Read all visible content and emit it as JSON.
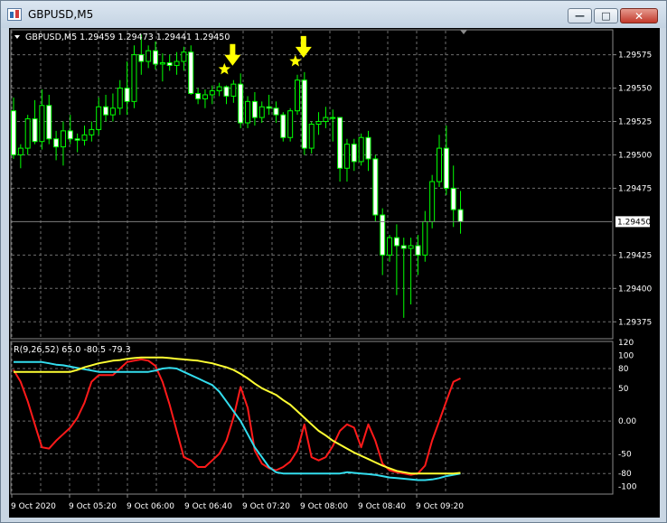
{
  "window": {
    "title": "GBPUSD,M5",
    "buttons": {
      "minimize_icon": "minimize-icon",
      "maximize_icon": "maximize-icon",
      "close_icon": "close-icon"
    }
  },
  "chart_data": [
    {
      "type": "candlestick",
      "header": "GBPUSD,M5  1.29459 1.29473 1.29441 1.29450",
      "symbol": "GBPUSD",
      "timeframe": "M5",
      "ohlc_text": "1.29459 1.29473 1.29441 1.29450",
      "ylim": [
        1.29363,
        1.29593
      ],
      "price_ticks": [
        "1.29575",
        "1.29550",
        "1.29525",
        "1.29500",
        "1.29475",
        "1.29425",
        "1.29400",
        "1.29375"
      ],
      "current_price": "1.29450",
      "current_price_value": 1.2945,
      "grid": true,
      "colors": {
        "background": "#000000",
        "candle": "#00ff00",
        "grid": "#6e6e6e",
        "signal": "#ffff00",
        "price_line": "#7f7f7f"
      },
      "signal_candles": [
        31,
        41
      ],
      "candles": [
        [
          1.29533,
          1.29543,
          1.29497,
          1.295
        ],
        [
          1.295,
          1.29508,
          1.2949,
          1.29505
        ],
        [
          1.29505,
          1.2953,
          1.295,
          1.29527
        ],
        [
          1.29527,
          1.29541,
          1.29508,
          1.2951
        ],
        [
          1.2951,
          1.29549,
          1.29504,
          1.29537
        ],
        [
          1.29537,
          1.29545,
          1.29508,
          1.29512
        ],
        [
          1.29512,
          1.29518,
          1.29496,
          1.29506
        ],
        [
          1.29506,
          1.29525,
          1.29492,
          1.29518
        ],
        [
          1.29518,
          1.2953,
          1.29508,
          1.29512
        ],
        [
          1.29512,
          1.29516,
          1.29502,
          1.29511
        ],
        [
          1.29511,
          1.29522,
          1.29507,
          1.29515
        ],
        [
          1.29515,
          1.29525,
          1.2951,
          1.29519
        ],
        [
          1.29519,
          1.29543,
          1.29515,
          1.29536
        ],
        [
          1.29536,
          1.29545,
          1.29525,
          1.2953
        ],
        [
          1.2953,
          1.29546,
          1.29525,
          1.29535
        ],
        [
          1.29535,
          1.29556,
          1.2953,
          1.2955
        ],
        [
          1.2955,
          1.2957,
          1.2953,
          1.2954
        ],
        [
          1.2954,
          1.29582,
          1.29535,
          1.29575
        ],
        [
          1.29575,
          1.2959,
          1.2956,
          1.2957
        ],
        [
          1.2957,
          1.29582,
          1.29565,
          1.29578
        ],
        [
          1.29578,
          1.29585,
          1.29564,
          1.29568
        ],
        [
          1.29568,
          1.29576,
          1.29555,
          1.29569
        ],
        [
          1.29569,
          1.29575,
          1.29563,
          1.29567
        ],
        [
          1.29567,
          1.29577,
          1.2956,
          1.2957
        ],
        [
          1.2957,
          1.29581,
          1.29563,
          1.29577
        ],
        [
          1.29577,
          1.29582,
          1.29545,
          1.29546
        ],
        [
          1.29546,
          1.2955,
          1.29538,
          1.29542
        ],
        [
          1.29542,
          1.29549,
          1.29535,
          1.29545
        ],
        [
          1.29545,
          1.29552,
          1.29538,
          1.29548
        ],
        [
          1.29548,
          1.29554,
          1.29544,
          1.29551
        ],
        [
          1.29551,
          1.29552,
          1.29538,
          1.29544
        ],
        [
          1.29544,
          1.29556,
          1.29539,
          1.29553
        ],
        [
          1.29553,
          1.29561,
          1.2952,
          1.29524
        ],
        [
          1.29524,
          1.29544,
          1.2952,
          1.2954
        ],
        [
          1.2954,
          1.29547,
          1.29522,
          1.29528
        ],
        [
          1.29528,
          1.2954,
          1.29524,
          1.29536
        ],
        [
          1.29536,
          1.29545,
          1.2953,
          1.29535
        ],
        [
          1.29535,
          1.2954,
          1.29524,
          1.2953
        ],
        [
          1.2953,
          1.29532,
          1.2951,
          1.29513
        ],
        [
          1.29513,
          1.29535,
          1.2951,
          1.29533
        ],
        [
          1.29533,
          1.2956,
          1.2953,
          1.29556
        ],
        [
          1.29556,
          1.29562,
          1.295,
          1.29505
        ],
        [
          1.29505,
          1.29525,
          1.29501,
          1.29523
        ],
        [
          1.29523,
          1.29532,
          1.29515,
          1.29525
        ],
        [
          1.29525,
          1.29536,
          1.2952,
          1.29528
        ],
        [
          1.29528,
          1.29534,
          1.2951,
          1.29528
        ],
        [
          1.29528,
          1.29526,
          1.2948,
          1.2949
        ],
        [
          1.2949,
          1.29512,
          1.2948,
          1.29508
        ],
        [
          1.29508,
          1.29512,
          1.29488,
          1.29495
        ],
        [
          1.29495,
          1.29516,
          1.29492,
          1.29513
        ],
        [
          1.29513,
          1.29518,
          1.29488,
          1.29497
        ],
        [
          1.29497,
          1.295,
          1.2945,
          1.29455
        ],
        [
          1.29455,
          1.2946,
          1.2941,
          1.29425
        ],
        [
          1.29425,
          1.2944,
          1.2942,
          1.29438
        ],
        [
          1.29438,
          1.29448,
          1.29395,
          1.29432
        ],
        [
          1.29432,
          1.29438,
          1.29378,
          1.2943
        ],
        [
          1.2943,
          1.29438,
          1.29388,
          1.29432
        ],
        [
          1.29432,
          1.2944,
          1.2941,
          1.29425
        ],
        [
          1.29425,
          1.29458,
          1.2942,
          1.2945
        ],
        [
          1.2945,
          1.29485,
          1.29445,
          1.2948
        ],
        [
          1.2948,
          1.29515,
          1.29476,
          1.29505
        ],
        [
          1.29505,
          1.29522,
          1.2947,
          1.29475
        ],
        [
          1.29475,
          1.29492,
          1.29446,
          1.29459
        ],
        [
          1.29459,
          1.29473,
          1.29441,
          1.2945
        ]
      ],
      "time_labels": [
        "9 Oct 2020",
        "9 Oct 05:20",
        "9 Oct 06:00",
        "9 Oct 06:40",
        "9 Oct 07:20",
        "9 Oct 08:00",
        "9 Oct 08:40",
        "9 Oct 09:20"
      ]
    },
    {
      "type": "line",
      "header": "R(9,26,52) 65.0 -80.5 -79.3",
      "ylim": [
        -110,
        120
      ],
      "y_ticks": [
        "120",
        "100",
        "80",
        "50",
        "0.00",
        "-50",
        "-80",
        "-100"
      ],
      "y_tick_values": [
        120,
        100,
        80,
        50,
        0,
        -50,
        -80,
        -100
      ],
      "grid": true,
      "series": [
        {
          "color": "#ff1a1a",
          "values": [
            78,
            60,
            30,
            -5,
            -40,
            -42,
            -30,
            -20,
            -10,
            5,
            28,
            60,
            70,
            70,
            70,
            80,
            90,
            92,
            94,
            92,
            84,
            60,
            25,
            -15,
            -55,
            -60,
            -70,
            -70,
            -60,
            -50,
            -30,
            5,
            52,
            20,
            -45,
            -65,
            -72,
            -75,
            -70,
            -62,
            -45,
            -5,
            -55,
            -60,
            -55,
            -38,
            -15,
            -5,
            -10,
            -40,
            -5,
            -30,
            -65,
            -75,
            -78,
            -80,
            -82,
            -80,
            -68,
            -30,
            0,
            30,
            60,
            65
          ]
        },
        {
          "color": "#33ddee",
          "values": [
            90,
            90,
            90,
            90,
            90,
            88,
            86,
            85,
            83,
            81,
            79,
            77,
            75,
            75,
            75,
            75,
            75,
            75,
            75,
            75,
            77,
            80,
            81,
            80,
            75,
            70,
            65,
            60,
            55,
            45,
            30,
            15,
            0,
            -20,
            -40,
            -55,
            -70,
            -78,
            -80,
            -80,
            -80,
            -80,
            -80,
            -80,
            -80,
            -80,
            -80,
            -78,
            -79,
            -80,
            -81,
            -82,
            -84,
            -86,
            -87,
            -88,
            -89,
            -90,
            -90,
            -89,
            -87,
            -84,
            -82,
            -80
          ]
        },
        {
          "color": "#ffff33",
          "values": [
            75,
            75,
            75,
            75,
            75,
            75,
            75,
            75,
            75,
            78,
            82,
            85,
            88,
            90,
            92,
            93,
            95,
            96,
            97,
            97,
            97,
            97,
            96,
            95,
            94,
            93,
            92,
            90,
            88,
            85,
            82,
            78,
            72,
            65,
            57,
            50,
            45,
            40,
            32,
            25,
            15,
            5,
            -5,
            -15,
            -22,
            -30,
            -36,
            -42,
            -48,
            -53,
            -58,
            -63,
            -68,
            -72,
            -76,
            -78,
            -80,
            -80,
            -80,
            -80,
            -80,
            -80,
            -80,
            -79
          ]
        }
      ]
    }
  ]
}
